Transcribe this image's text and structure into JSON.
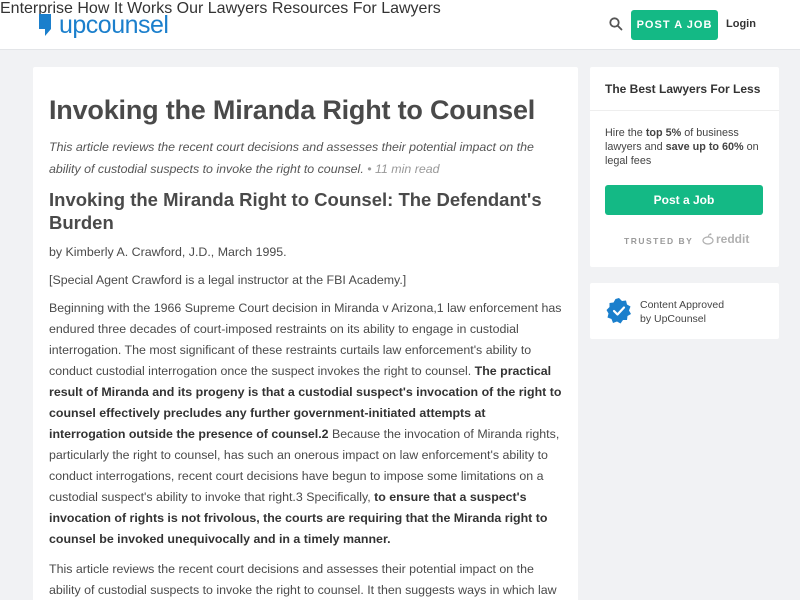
{
  "header": {
    "logo_text": "upcounsel",
    "nav": [
      "Enterprise",
      "How It Works",
      "Our Lawyers",
      "Resources",
      "For Lawyers"
    ],
    "post_job": "POST A JOB",
    "login": "Login"
  },
  "article": {
    "title": "Invoking the Miranda Right to Counsel",
    "intro": "This article reviews the recent court decisions and assesses their potential impact on the ability of custodial suspects to invoke the right to counsel.",
    "read_time": "• 11 min read",
    "subtitle": "Invoking the Miranda Right to Counsel: The Defendant's Burden",
    "byline": "by Kimberly A. Crawford, J.D., March 1995.",
    "note": "[Special Agent Crawford is a legal instructor at the FBI Academy.]",
    "para1": {
      "t1": "Beginning with the 1966 Supreme Court decision in Miranda v Arizona,1 law enforcement has endured three decades of court-imposed restraints on its ability to engage in custodial interrogation. The most significant of these restraints curtails law enforcement's ability to conduct custodial interrogation once the suspect invokes the right to counsel. ",
      "b1": "The practical result of Miranda and its progeny is that a custodial suspect's invocation of the right to counsel effectively precludes any further government-initiated attempts at interrogation outside the presence of counsel.2",
      "t2": " Because the invocation of Miranda rights, particularly the right to counsel, has such an onerous impact on law enforcement's ability to conduct interrogations, recent court decisions have begun to impose some limitations on a custodial suspect's ability to invoke that right.3 Specifically, ",
      "b2": "to ensure that a suspect's invocation of rights is not frivolous, the courts are requiring that the Miranda right to counsel be invoked unequivocally and in a timely manner."
    },
    "para2": "This article reviews the recent court decisions and assesses their potential impact on the ability of custodial suspects to invoke the right to counsel. It then suggests ways in which law enforcement"
  },
  "sidebar": {
    "card_title": "The Best Lawyers For Less",
    "desc_1": "Hire the ",
    "desc_b1": "top 5%",
    "desc_2": " of business lawyers and ",
    "desc_b2": "save up to 60%",
    "desc_3": " on legal fees",
    "cta": "Post a Job",
    "trusted": "TRUSTED BY",
    "reddit": "reddit",
    "approved_1": "Content Approved",
    "approved_2": "by UpCounsel"
  },
  "colors": {
    "brand_blue": "#1b7fcc",
    "green": "#14b985"
  }
}
